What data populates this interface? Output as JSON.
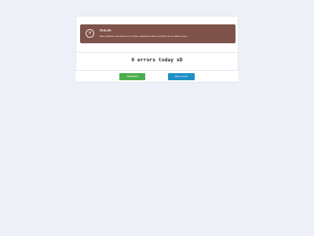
{
  "alert": {
    "icon": "close-icon",
    "icon_glyph": "×",
    "title": "FEHLER",
    "message": "Beim Ausführen der Aktion ist ein Fehler aufgetreten! Bitte versuchen Sie es später erneut.",
    "background_color": "#7e534a"
  },
  "main": {
    "heading": "0 errors today xD"
  },
  "actions": {
    "primary_label": "Add ERROR",
    "secondary_label": "Reset counter",
    "primary_color": "#4cae4c",
    "secondary_color": "#1f8fc4"
  }
}
